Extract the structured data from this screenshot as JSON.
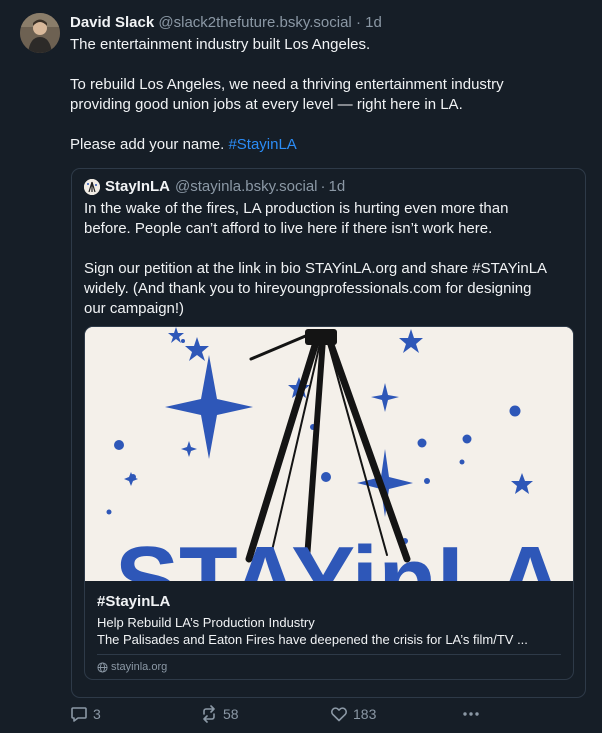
{
  "post": {
    "author_name": "David Slack",
    "author_handle": "@slack2thefuture.bsky.social",
    "separator": "·",
    "time": "1d",
    "avatar_icon": "user-photo-icon",
    "line1": "The entertainment industry built Los Angeles.",
    "line2a": "To rebuild Los Angeles, we need a thriving entertainment industry",
    "line2b": "providing good union jobs at every level — right here in LA.",
    "line3": "Please add your name.",
    "hashtag": "#StayinLA"
  },
  "quote": {
    "author_name": "StayInLA",
    "author_handle": "@stayinla.bsky.social",
    "separator": "·",
    "time": "1d",
    "p1a": "In the wake of the fires, LA production is hurting even more than",
    "p1b": "before. People can’t afford to live here if there isn’t work here.",
    "p2a": "Sign our petition at the link in bio STAYinLA.org and share #STAYinLA",
    "p2b": "widely. (And thank you to hireyoungprofessionals.com for designing",
    "p2c": "our campaign!)"
  },
  "card": {
    "title": "#StayinLA",
    "subtitle": "Help Rebuild LA’s Production Industry",
    "description": "The Palisades and Eaton Fires have deepened the crisis for LA’s film/TV ...",
    "domain": "stayinla.org",
    "domain_icon": "globe-icon",
    "image_text": "STAYinLA",
    "image_bg": "#f4f0ea",
    "image_accent": "#2e57b8"
  },
  "actions": {
    "replies": "3",
    "reposts": "58",
    "likes": "183",
    "reply_icon": "reply-icon",
    "repost_icon": "repost-icon",
    "like_icon": "heart-icon",
    "more_icon": "more-options-icon"
  },
  "colors": {
    "background": "#161e27",
    "text": "#f1f3f5",
    "muted": "#8b98a5",
    "link": "#2b8cf6",
    "border": "#2e3a48"
  }
}
